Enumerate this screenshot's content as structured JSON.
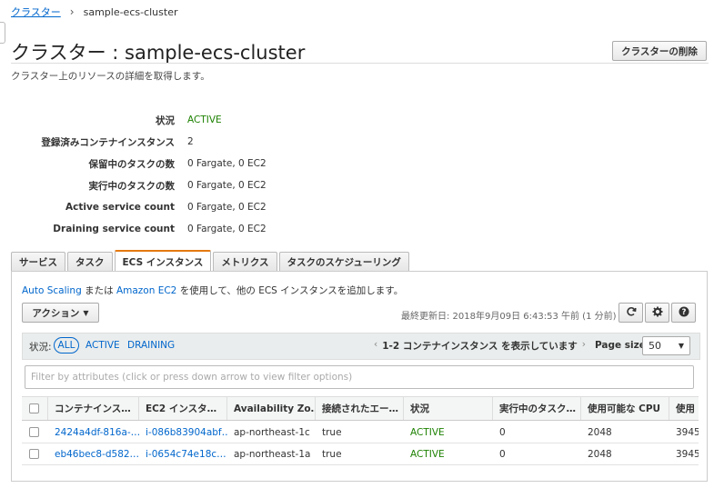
{
  "breadcrumb": {
    "root": "クラスター",
    "current": "sample-ecs-cluster"
  },
  "header": {
    "title": "クラスター : sample-ecs-cluster",
    "delete_button": "クラスターの削除",
    "subtitle": "クラスター上のリソースの詳細を取得します。"
  },
  "details": [
    {
      "label": "状況",
      "value": "ACTIVE"
    },
    {
      "label": "登録済みコンテナインスタンス",
      "value": "2"
    },
    {
      "label": "保留中のタスクの数",
      "value": "0 Fargate, 0 EC2"
    },
    {
      "label": "実行中のタスクの数",
      "value": "0 Fargate, 0 EC2"
    },
    {
      "label": "Active service count",
      "value": "0 Fargate, 0 EC2"
    },
    {
      "label": "Draining service count",
      "value": "0 Fargate, 0 EC2"
    }
  ],
  "tabs": [
    "サービス",
    "タスク",
    "ECS インスタンス",
    "メトリクス",
    "タスクのスケジューリング"
  ],
  "active_tab": "ECS インスタンス",
  "instances": {
    "info_link1": "Auto Scaling",
    "info_mid": " または ",
    "info_link2": "Amazon EC2",
    "info_rest": " を使用して、他の ECS インスタンスを追加します。",
    "action_button": "アクション",
    "last_updated": "最終更新日: 2018年9月09日 6:43:53 午前 (1 分前)",
    "refresh_icon": "refresh-icon",
    "settings_icon": "gear-icon",
    "help_icon": "help-icon",
    "status_label": "状況:",
    "status_filters": [
      "ALL",
      "ACTIVE",
      "DRAINING"
    ],
    "range_text": "1-2 コンテナインスタンス を表示しています",
    "page_size_label": "Page size",
    "page_size": "50",
    "filter_placeholder": "Filter by attributes (click or press down arrow to view filter options)",
    "columns": [
      "コンテナインス…",
      "EC2 インスタ…",
      "Availability Zo…",
      "接続されたエー…",
      "状況",
      "実行中のタスク…",
      "使用可能な CPU",
      "使用"
    ],
    "rows": [
      [
        "2424a4df-816a-…",
        "i-086b83904abf…",
        "ap-northeast-1c",
        "true",
        "ACTIVE",
        "0",
        "2048",
        "3945"
      ],
      [
        "eb46bec8-d582…",
        "i-0654c74e18c…",
        "ap-northeast-1a",
        "true",
        "ACTIVE",
        "0",
        "2048",
        "3945"
      ]
    ]
  },
  "colors": {
    "link": "#0066cc",
    "active": "#1d8102",
    "tab_accent": "#e47911"
  }
}
